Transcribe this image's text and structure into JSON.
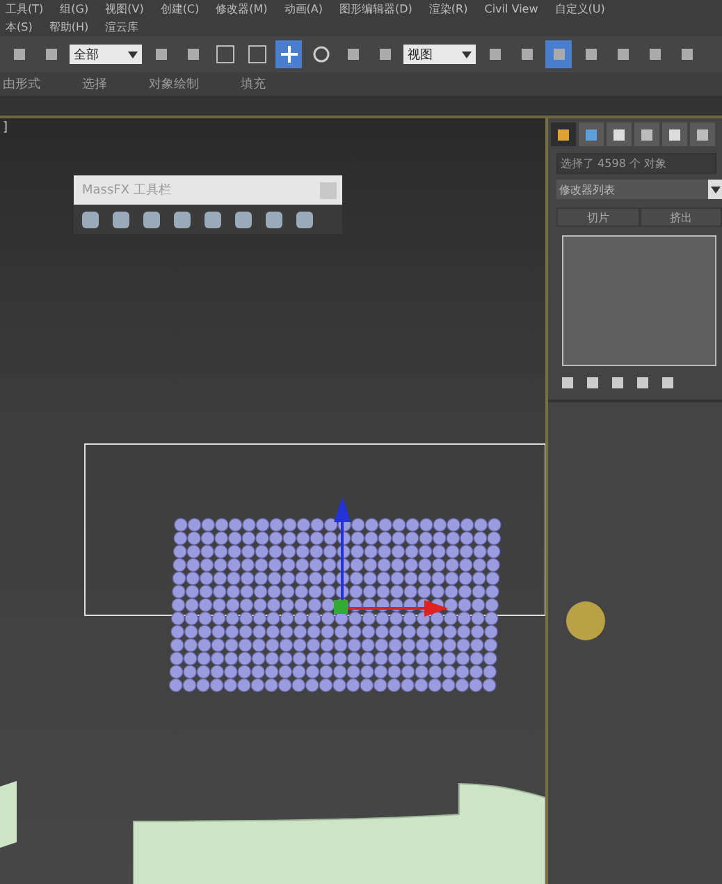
{
  "menu_bar": {
    "rows": [
      [
        "工具(T)",
        "组(G)",
        "视图(V)",
        "创建(C)",
        "修改器(M)",
        "动画(A)",
        "图形编辑器(D)",
        "渲染(R)",
        "Civil View",
        "自定义(U)"
      ],
      [
        "本(S)",
        "帮助(H)",
        "渲云库"
      ]
    ]
  },
  "toolbar": {
    "buttons": [
      {
        "kind": "tool",
        "active": false
      },
      {
        "kind": "tool",
        "active": false
      },
      {
        "kind": "dropdown",
        "value": "全部"
      },
      {
        "kind": "tool",
        "active": false
      },
      {
        "kind": "tool",
        "active": false
      },
      {
        "kind": "tool",
        "active": false
      },
      {
        "kind": "tool",
        "active": false
      },
      {
        "kind": "tool",
        "active": true
      },
      {
        "kind": "tool",
        "active": false
      },
      {
        "kind": "tool",
        "active": false
      },
      {
        "kind": "tool",
        "active": false
      },
      {
        "kind": "dropdown",
        "value": "视图"
      },
      {
        "kind": "tool",
        "active": false
      },
      {
        "kind": "tool",
        "active": false
      },
      {
        "kind": "tool",
        "active": true
      },
      {
        "kind": "tool",
        "active": false
      },
      {
        "kind": "tool",
        "active": false
      },
      {
        "kind": "tool",
        "active": false
      },
      {
        "kind": "tool",
        "active": false
      }
    ]
  },
  "ribbon": {
    "tabs": [
      "由形式",
      "选择",
      "对象绘制",
      "填充"
    ]
  },
  "viewport": {
    "label": "]"
  },
  "massfx_toolbar": {
    "title": "MassFX 工具栏"
  },
  "command_panel": {
    "tabs": [
      {
        "selected": true
      },
      {
        "selected": false
      },
      {
        "selected": false
      },
      {
        "selected": false
      },
      {
        "selected": false
      },
      {
        "selected": false
      }
    ],
    "object_name": "选择了 4598 个 对象",
    "modifier_list": "修改器列表",
    "quick_buttons": [
      "切片",
      "挤出"
    ]
  }
}
